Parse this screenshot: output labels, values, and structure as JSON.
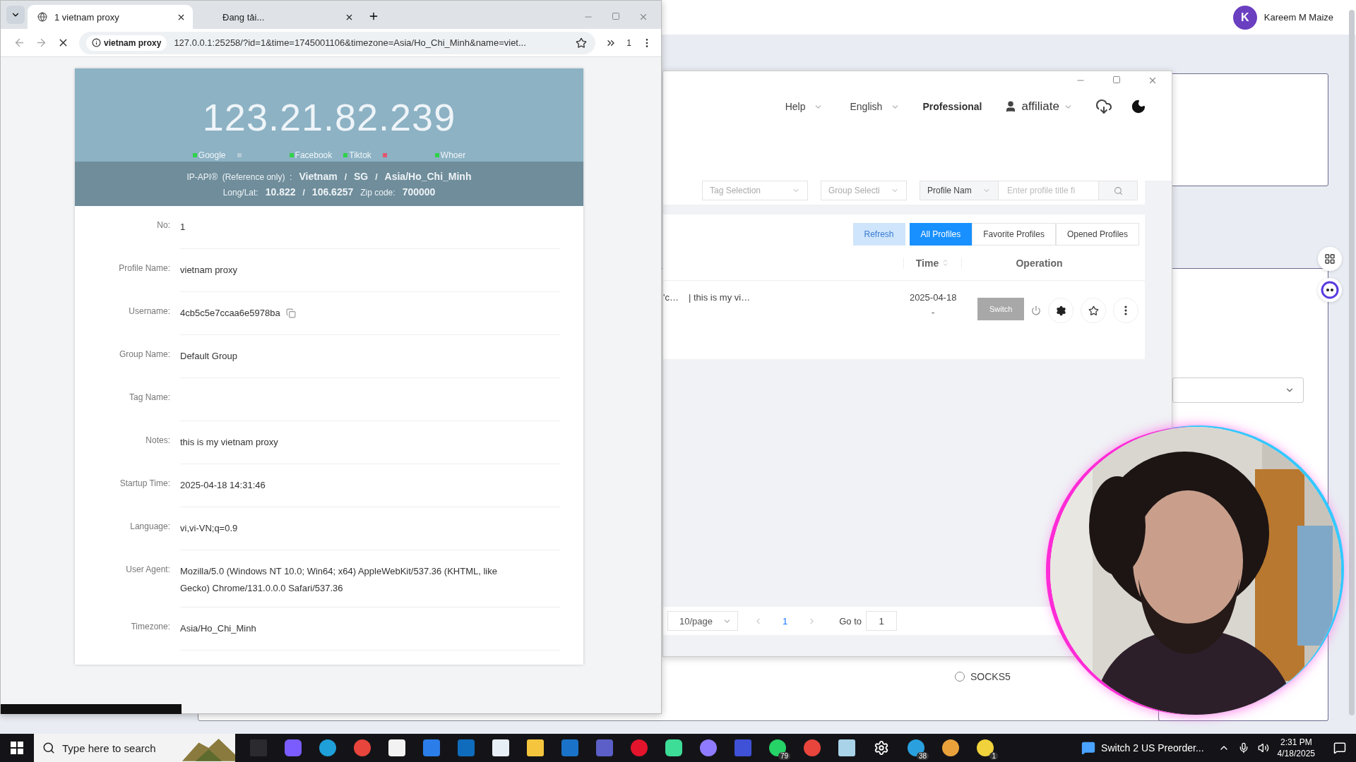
{
  "desktop_page": {
    "user": {
      "initial": "K",
      "name": "Kareem M Maize"
    },
    "proxy_option": {
      "label": "SOCKS5",
      "selected": false
    }
  },
  "browser": {
    "tabs": [
      {
        "title": "1 vietnam proxy",
        "selected": true
      },
      {
        "title": "Đang tải...",
        "selected": false
      }
    ],
    "site_chip": "vietnam proxy",
    "url": "127.0.0.1:25258/?id=1&time=1745001106&timezone=Asia/Ho_Chi_Minh&name=viet...",
    "extension_count": "1"
  },
  "ip_card": {
    "ip": "123.21.82.239",
    "checks": [
      {
        "label": "Google",
        "color": "#2fd24a"
      },
      {
        "color": "#b4cad6"
      },
      {
        "label": "Facebook",
        "color": "#2fd24a"
      },
      {
        "label": "Tiktok",
        "color": "#2fd24a"
      },
      {
        "color": "#e4566e"
      },
      {
        "label": "Whoer",
        "color": "#2fd24a"
      }
    ],
    "geo_line": [
      {
        "kind": "label",
        "text": "IP-API®  (Reference only)  :"
      },
      {
        "kind": "value",
        "text": "Vietnam"
      },
      {
        "kind": "sep",
        "text": "/"
      },
      {
        "kind": "value",
        "text": "SG"
      },
      {
        "kind": "sep",
        "text": "/"
      },
      {
        "kind": "value",
        "text": "Asia/Ho_Chi_Minh"
      }
    ],
    "coord_line": [
      {
        "kind": "label",
        "text": "Long/Lat:"
      },
      {
        "kind": "value",
        "text": "10.822"
      },
      {
        "kind": "sep",
        "text": "/"
      },
      {
        "kind": "value",
        "text": "106.6257"
      },
      {
        "kind": "label",
        "text": "Zip code:"
      },
      {
        "kind": "value",
        "text": "700000"
      }
    ],
    "details": [
      {
        "label": "No:",
        "value": "1",
        "kind": "text"
      },
      {
        "label": "Profile Name:",
        "value": "vietnam proxy",
        "kind": "text"
      },
      {
        "label": "Username:",
        "value": "4cb5c5e7ccaa6e5978ba",
        "kind": "copy"
      },
      {
        "label": "Group Name:",
        "value": "Default Group",
        "kind": "text"
      },
      {
        "label": "Tag Name:",
        "kind": "text"
      },
      {
        "label": "Notes:",
        "value": "this is my vietnam proxy",
        "kind": "text"
      },
      {
        "label": "Startup Time:",
        "value": "2025-04-18 14:31:46",
        "kind": "text"
      },
      {
        "label": "Language:",
        "value": "vi,vi-VN;q=0.9",
        "kind": "text"
      },
      {
        "label": "User Agent:",
        "value": "Mozilla/5.0 (Windows NT 10.0; Win64; x64) AppleWebKit/537.36 (KHTML, like Gecko) Chrome/131.0.0.0 Safari/537.36",
        "kind": "text"
      },
      {
        "label": "Timezone:",
        "value": "Asia/Ho_Chi_Minh",
        "kind": "text"
      }
    ]
  },
  "app_window": {
    "menu": [
      {
        "label": "Help"
      },
      {
        "label": "English"
      }
    ],
    "plan": "Professional",
    "account": "affiliate",
    "filters": {
      "tag": "Tag Selection",
      "group": "Group Selecti",
      "field": "Profile Nam",
      "placeholder": "Enter profile title fi"
    },
    "refresh": "Refresh",
    "views": [
      {
        "label": "All Profiles",
        "selected": true
      },
      {
        "label": "Favorite Profiles",
        "selected": false
      },
      {
        "label": "Opened Profiles",
        "selected": false
      }
    ],
    "columns": [
      "Time",
      "Operation"
    ],
    "rows": [
      {
        "name": "'c…",
        "notes": "| this is my vi…",
        "date": "2025-04-18",
        "date_2": "-",
        "action": "Switch",
        "action_disabled": true
      }
    ],
    "pagination": {
      "page_size": "10/page",
      "current": "1",
      "goto_label": "Go to",
      "goto_value": "1"
    }
  },
  "taskbar": {
    "search_placeholder": "Type here to search",
    "badges": [
      "79",
      "38",
      "1"
    ],
    "notification": "Switch 2 US Preorder...",
    "time": "2:31 PM",
    "date": "4/18/2025"
  }
}
